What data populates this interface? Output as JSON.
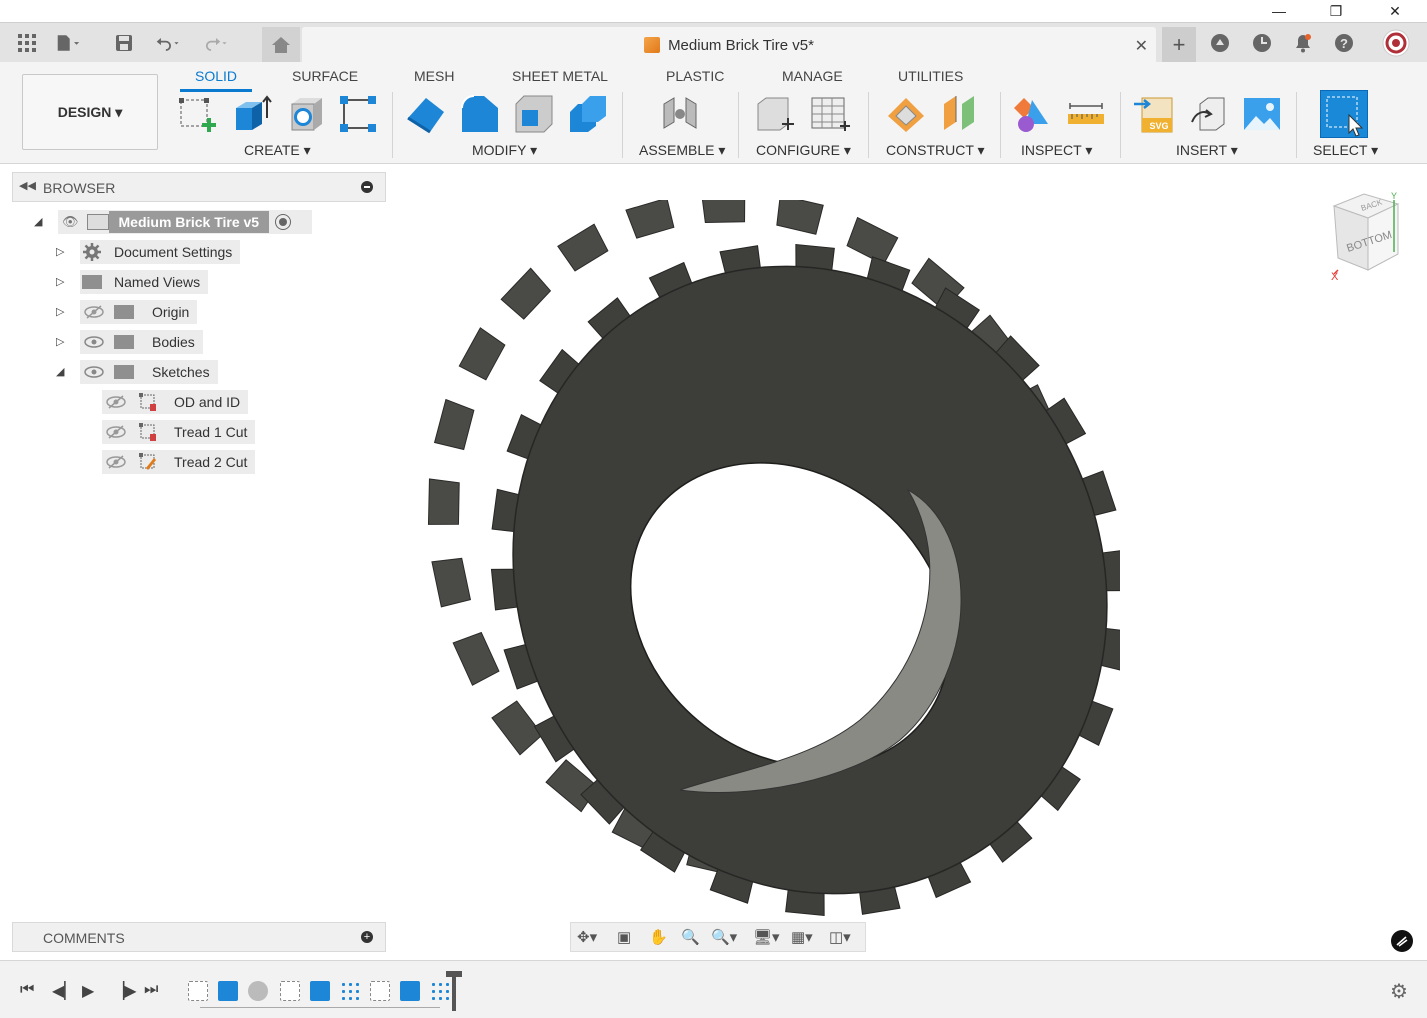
{
  "window": {
    "minimize_glyph": "—",
    "maximize_glyph": "❐",
    "close_glyph": "✕"
  },
  "tabbar": {
    "document_title": "Medium Brick Tire v5*",
    "add_tab_glyph": "+"
  },
  "ribbon": {
    "workspace_button": "DESIGN ▾",
    "tabs": [
      {
        "label": "SOLID",
        "active": true
      },
      {
        "label": "SURFACE"
      },
      {
        "label": "MESH"
      },
      {
        "label": "SHEET METAL"
      },
      {
        "label": "PLASTIC"
      },
      {
        "label": "MANAGE"
      },
      {
        "label": "UTILITIES"
      }
    ],
    "groups": [
      {
        "label": "CREATE ▾"
      },
      {
        "label": "MODIFY ▾"
      },
      {
        "label": "ASSEMBLE ▾"
      },
      {
        "label": "CONFIGURE ▾"
      },
      {
        "label": "CONSTRUCT ▾"
      },
      {
        "label": "INSPECT ▾"
      },
      {
        "label": "INSERT ▾"
      },
      {
        "label": "SELECT ▾"
      }
    ]
  },
  "browser": {
    "title": "BROWSER",
    "root": "Medium Brick Tire v5",
    "items": [
      {
        "label": "Document Settings"
      },
      {
        "label": "Named Views"
      },
      {
        "label": "Origin"
      },
      {
        "label": "Bodies"
      },
      {
        "label": "Sketches"
      }
    ],
    "sketches": [
      {
        "label": "OD and ID"
      },
      {
        "label": "Tread 1 Cut"
      },
      {
        "label": "Tread 2 Cut"
      }
    ]
  },
  "comments": {
    "title": "COMMENTS"
  },
  "viewcube": {
    "top_face": "BACK",
    "front_face": "BOTTOM",
    "axis_x": "X",
    "axis_y": "Y"
  },
  "colors": {
    "accent": "#0a7ad0",
    "tire": "#3f3f3c",
    "tire_light": "#6a6a66"
  }
}
